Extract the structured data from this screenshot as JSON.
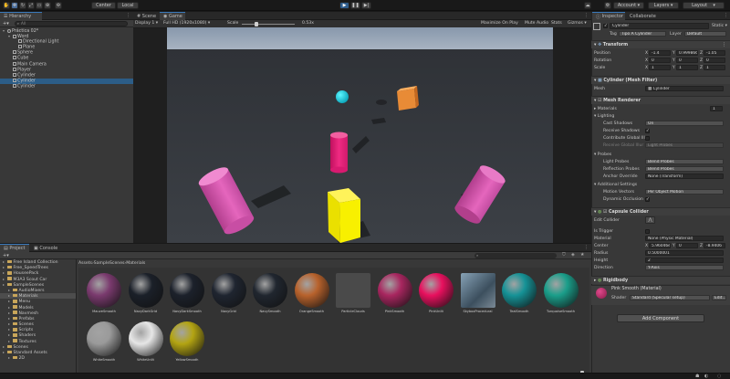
{
  "toolbar": {
    "center_label": "Center",
    "local_label": "Local",
    "account_label": "Account",
    "layers_label": "Layers",
    "layout_label": "Layout"
  },
  "hierarchy": {
    "tab_label": "Hierarchy",
    "search_placeholder": "All",
    "items": [
      {
        "label": "Práctica 02*",
        "indent": 0,
        "expand": "▾"
      },
      {
        "label": "Word",
        "indent": 1,
        "expand": "▾"
      },
      {
        "label": "Directional Light",
        "indent": 2,
        "expand": ""
      },
      {
        "label": "Plane",
        "indent": 2,
        "expand": ""
      },
      {
        "label": "Sphere",
        "indent": 1,
        "expand": ""
      },
      {
        "label": "Cube",
        "indent": 1,
        "expand": ""
      },
      {
        "label": "Main Camera",
        "indent": 1,
        "expand": ""
      },
      {
        "label": "Player",
        "indent": 1,
        "expand": ""
      },
      {
        "label": "Cylinder",
        "indent": 1,
        "expand": ""
      },
      {
        "label": "Cylinder",
        "indent": 1,
        "expand": "",
        "selected": true
      },
      {
        "label": "Cylinder",
        "indent": 1,
        "expand": ""
      }
    ]
  },
  "game_view": {
    "scene_tab": "Scene",
    "game_tab": "Game",
    "display": "Display 1",
    "resolution": "Full HD (1920x1080)",
    "scale_label": "Scale",
    "scale_value": "0.53x",
    "maximize": "Maximize On Play",
    "mute": "Mute Audio",
    "stats": "Stats",
    "gizmos": "Gizmos"
  },
  "project": {
    "project_tab": "Project",
    "console_tab": "Console",
    "folders": [
      {
        "label": "Free Island Collection",
        "indent": 0
      },
      {
        "label": "Free_SpeedTrees",
        "indent": 0
      },
      {
        "label": "HouseePack",
        "indent": 0
      },
      {
        "label": "M3A3 Scout Car",
        "indent": 0
      },
      {
        "label": "SampleScenes",
        "indent": 0
      },
      {
        "label": "AudioMixers",
        "indent": 1
      },
      {
        "label": "Materials",
        "indent": 1,
        "selected": true
      },
      {
        "label": "Menu",
        "indent": 1
      },
      {
        "label": "Models",
        "indent": 1
      },
      {
        "label": "Navmesh",
        "indent": 1
      },
      {
        "label": "Prefabs",
        "indent": 1
      },
      {
        "label": "Scenes",
        "indent": 1
      },
      {
        "label": "Scripts",
        "indent": 1
      },
      {
        "label": "Shaders",
        "indent": 1
      },
      {
        "label": "Textures",
        "indent": 1
      },
      {
        "label": "Scenes",
        "indent": 0
      },
      {
        "label": "Standard Assets",
        "indent": 0
      },
      {
        "label": "2D",
        "indent": 1
      }
    ],
    "breadcrumb": [
      "Assets",
      "SampleScenes",
      "Materials"
    ],
    "assets": [
      {
        "label": "MauveSmooth",
        "color": "#7a3a6e"
      },
      {
        "label": "NavyDarkGrid",
        "color": "#1b2029"
      },
      {
        "label": "NavyDarkSmooth",
        "color": "#1c212b"
      },
      {
        "label": "NavyGrid",
        "color": "#1f2530"
      },
      {
        "label": "NavySmooth",
        "color": "#20262f"
      },
      {
        "label": "OrangeSmooth",
        "color": "#b8622c"
      },
      {
        "label": "ParticleClouds",
        "color": "#4a4a4a"
      },
      {
        "label": "PinkSmooth",
        "color": "#a8265f"
      },
      {
        "label": "PinkUnlit",
        "color": "#e8105e"
      },
      {
        "label": "SkyboxProcedural",
        "color": "#5d7487"
      },
      {
        "label": "TealSmooth",
        "color": "#159296"
      },
      {
        "label": "TurquoiseSmooth",
        "color": "#1a9e8a"
      },
      {
        "label": "WhiteSmooth",
        "color": "#9a9a9a"
      },
      {
        "label": "WhiteUnlit",
        "color": "#e6e6e6"
      },
      {
        "label": "YellowSmooth",
        "color": "#b3a412"
      }
    ]
  },
  "inspector": {
    "inspector_tab": "Inspector",
    "collaborate_tab": "Collaborate",
    "object_name": "Cylinder",
    "static_label": "Static",
    "tag_label": "Tag",
    "tag_value": "Tipo A Cylinder",
    "layer_label": "Layer",
    "layer_value": "Default",
    "transform": {
      "title": "Transform",
      "position_label": "Position",
      "rotation_label": "Rotation",
      "scale_label": "Scale",
      "pos": [
        "-1.4",
        "0.999866",
        "-1.05"
      ],
      "rot": [
        "0",
        "0",
        "0"
      ],
      "scl": [
        "1",
        "1",
        "1"
      ]
    },
    "mesh_filter": {
      "title": "Cylinder (Mesh Filter)",
      "mesh_label": "Mesh",
      "mesh_value": "Cylinder"
    },
    "mesh_renderer": {
      "title": "Mesh Renderer",
      "materials": "Materials",
      "materials_count": "1",
      "lighting": "Lighting",
      "cast_shadows": "Cast Shadows",
      "cast_shadows_value": "On",
      "receive_shadows": "Receive Shadows",
      "contribute_gi": "Contribute Global Ill",
      "receive_gi": "Receive Global Illur",
      "receive_gi_value": "Light Probes",
      "probes": "Probes",
      "light_probes": "Light Probes",
      "light_probes_value": "Blend Probes",
      "reflection_probes": "Reflection Probes",
      "reflection_probes_value": "Blend Probes",
      "anchor_override": "Anchor Override",
      "anchor_override_value": "None (Transform)",
      "additional": "Additional Settings",
      "motion_vectors": "Motion Vectors",
      "motion_vectors_value": "Per Object Motion",
      "dynamic_occlusion": "Dynamic Occlusion"
    },
    "capsule_collider": {
      "title": "Capsule Collider",
      "edit_collider": "Edit Collider",
      "is_trigger": "Is Trigger",
      "material": "Material",
      "material_value": "None (Physic Material)",
      "center": "Center",
      "center_vals": [
        "5.96046e",
        "0",
        "-8.9406"
      ],
      "radius": "Radius",
      "radius_value": "0.5000001",
      "height": "Height",
      "height_value": "2",
      "direction": "Direction",
      "direction_value": "Y-Axis"
    },
    "rigidbody": {
      "title": "Rigidbody"
    },
    "material_block": {
      "name": "Pink Smooth (Material)",
      "shader_label": "Shader",
      "shader_value": "Standard (Specular setup)",
      "edit_label": "Edit..."
    },
    "add_component": "Add Component"
  }
}
